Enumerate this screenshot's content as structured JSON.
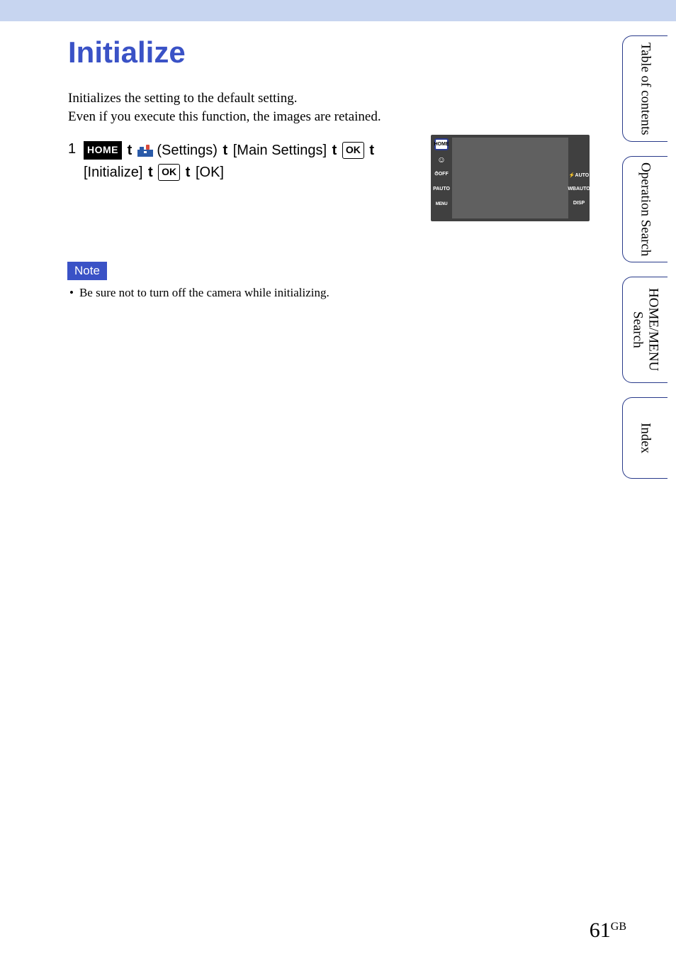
{
  "page": {
    "title": "Initialize",
    "intro_line1": "Initializes the setting to the default setting.",
    "intro_line2": "Even if you execute this function, the images are retained.",
    "number": "61",
    "number_suffix": "GB"
  },
  "step": {
    "num": "1",
    "home_icon_label": "HOME",
    "settings_label": " (Settings) ",
    "main_settings": " [Main Settings] ",
    "ok_icon": "OK",
    "initialize_text": " [Initialize] ",
    "final_ok": " [OK]",
    "arrow": "t"
  },
  "note": {
    "label": "Note",
    "item1": "Be sure not to turn off the camera while initializing."
  },
  "sidetabs": {
    "toc": "Table of contents",
    "operation": "Operation Search",
    "homemenu": "HOME/MENU Search",
    "index": "Index"
  },
  "camera_icons": {
    "home": "HOME",
    "smile": "☺",
    "timer_off": "⏱OFF",
    "pauto": "PAUTO",
    "menu": "MENU",
    "flash": "⚡AUTO",
    "wb": "WBAUTO",
    "disp": "DISP"
  }
}
